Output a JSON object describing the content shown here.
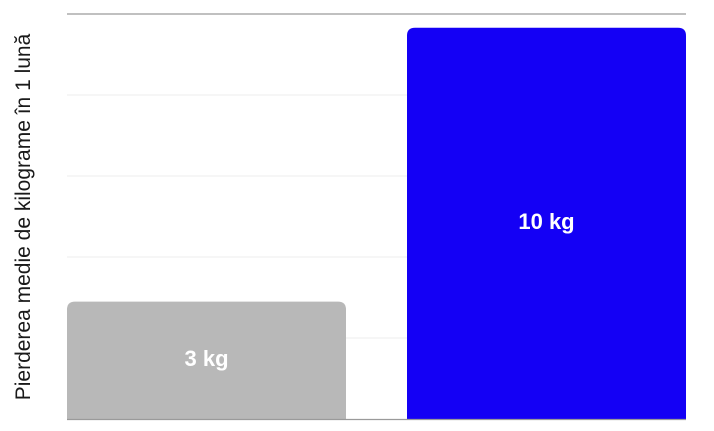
{
  "chart_data": {
    "type": "bar",
    "categories": [
      "",
      ""
    ],
    "values": [
      3,
      10
    ],
    "value_labels": [
      "3 kg",
      "10 kg"
    ],
    "colors": [
      "#b8b8b8",
      "#1400f5"
    ],
    "ylabel": "Pierderea medie de kilograme în 1 lună",
    "xlabel": "",
    "title": "",
    "ylim": [
      0,
      10.35
    ],
    "grid": true,
    "legend": "none"
  }
}
